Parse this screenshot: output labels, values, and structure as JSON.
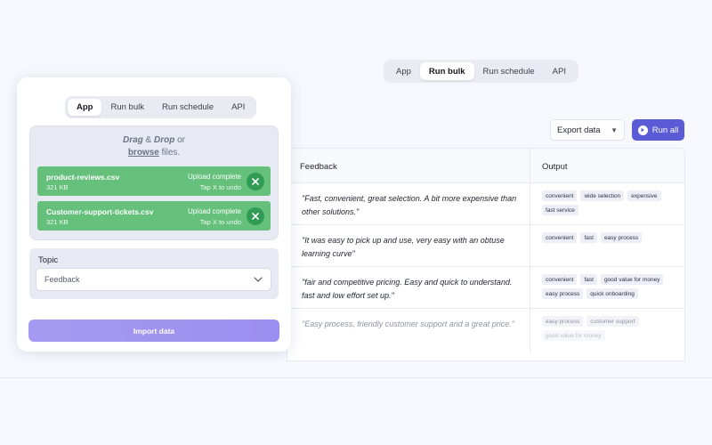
{
  "background_tabs": [
    "App",
    "Run bulk",
    "Run schedule",
    "API"
  ],
  "background_active_tab": "Run bulk",
  "toolbar": {
    "export_label": "Export data",
    "run_all_label": "Run all"
  },
  "table": {
    "headers": [
      "Feedback",
      "Output"
    ],
    "rows": [
      {
        "feedback": "\"Fast, convenient, great selection. A bit more expensive than other solutions.\"",
        "tags": [
          "convenient",
          "wide selection",
          "expensive",
          "fast service"
        ]
      },
      {
        "feedback": "\"It was easy to pick up and use, very easy with an obtuse learning curve\"",
        "tags": [
          "convenient",
          "fast",
          "easy process"
        ]
      },
      {
        "feedback": "\"fair and competitive pricing. Easy and quick to understand. fast and low effort set up.\"",
        "tags": [
          "convenient",
          "fast",
          "good value for money",
          "easy process",
          "quick onboarding"
        ]
      },
      {
        "feedback": "\"Easy process, friendly customer support and a great price.\"",
        "tags": [
          "easy process",
          "customer support",
          "good value for money"
        ]
      }
    ]
  },
  "card": {
    "tabs": [
      "App",
      "Run bulk",
      "Run schedule",
      "API"
    ],
    "active_tab": "App",
    "drop": {
      "drag": "Drag",
      "amp": " & ",
      "drop": "Drop",
      "or": " or",
      "browse": "browse",
      "files": " files."
    },
    "files": [
      {
        "name": "product-reviews.csv",
        "size": "321 KB",
        "status": "Upload complete",
        "undo": "Tap X to undo"
      },
      {
        "name": "Customer-support-tickets.csv",
        "size": "321 KB",
        "status": "Upload complete",
        "undo": "Tap X to undo"
      }
    ],
    "topic_label": "Topic",
    "topic_value": "Feedback",
    "import_label": "Import data"
  },
  "colors": {
    "accent": "#5b5bd6",
    "upload_green": "#64c07b",
    "import_purple": "#a59af1"
  }
}
